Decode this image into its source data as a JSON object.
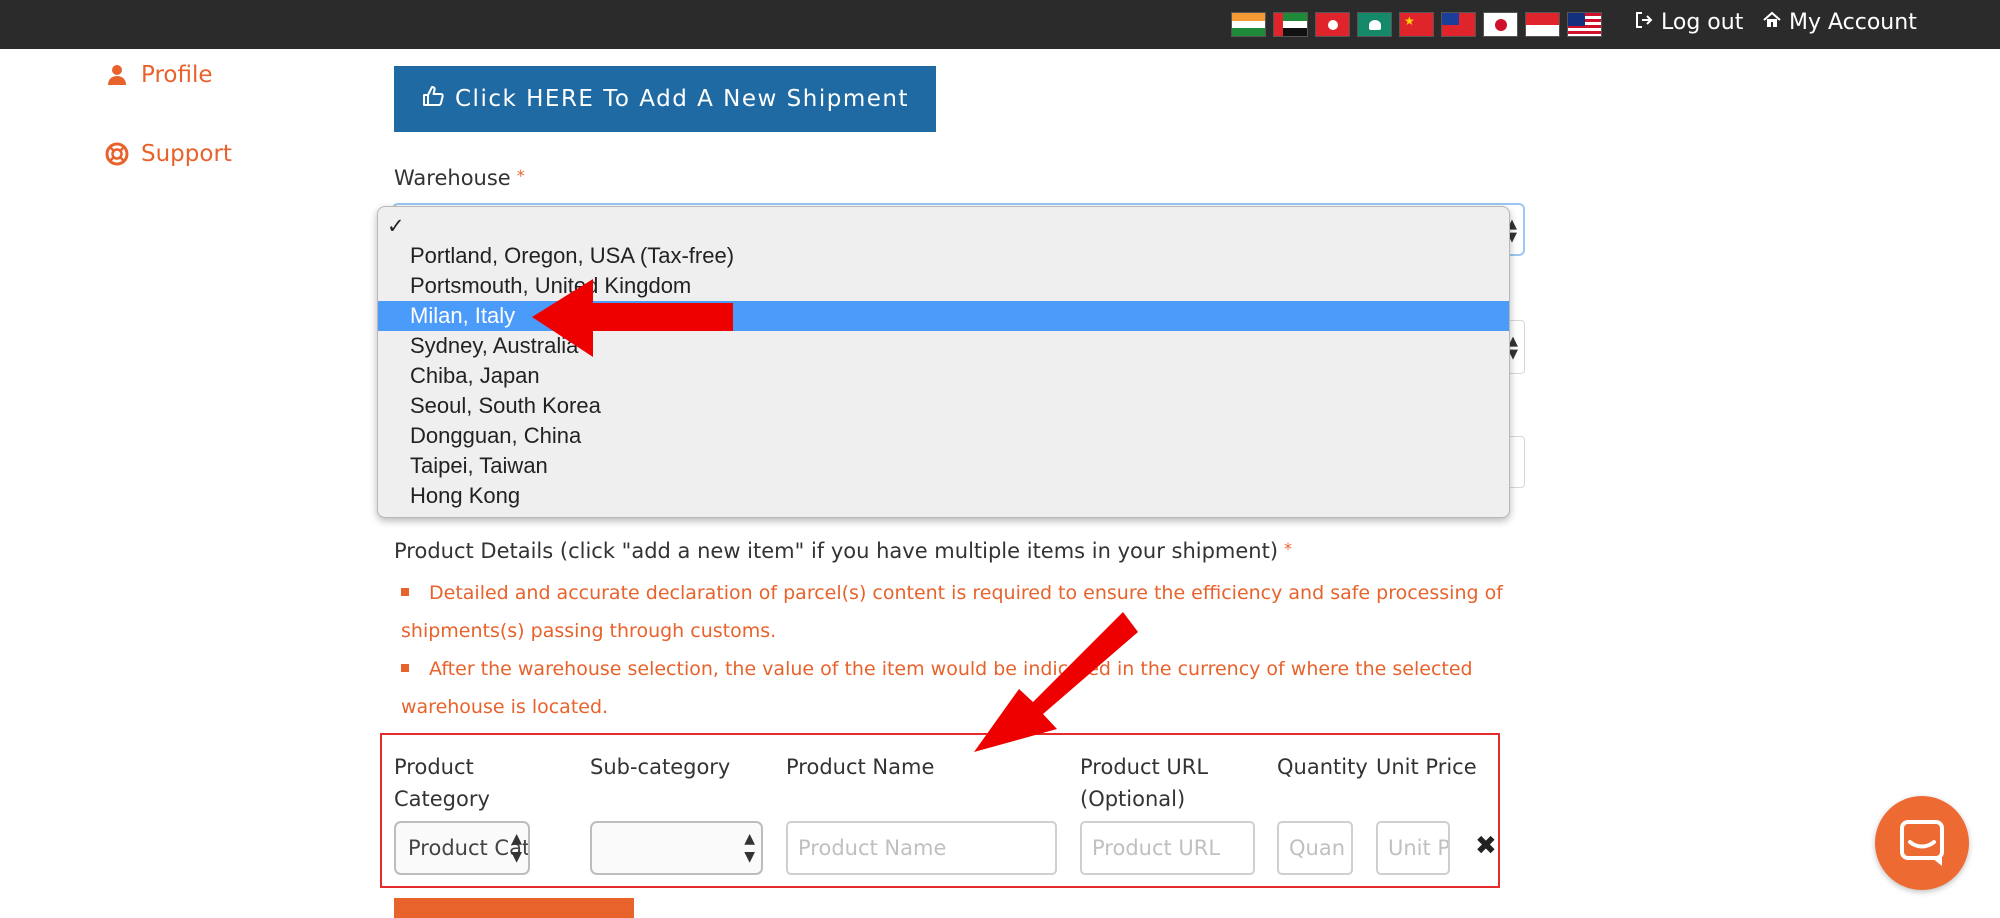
{
  "topbar": {
    "flags": [
      "flag-india-icon",
      "flag-uae-icon",
      "flag-hongkong-icon",
      "flag-macau-icon",
      "flag-china-icon",
      "flag-taiwan-icon",
      "flag-japan-icon",
      "flag-singapore-icon",
      "flag-malaysia-icon"
    ],
    "logout_label": "Log out",
    "account_label": "My Account"
  },
  "sidebar": {
    "items": [
      {
        "label": "Profile",
        "icon": "user-icon"
      },
      {
        "label": "Support",
        "icon": "lifebuoy-icon"
      }
    ]
  },
  "add_shipment_button": "Click HERE To Add A New Shipment",
  "warehouse": {
    "label": "Warehouse",
    "required_mark": "*",
    "check_mark": "✓",
    "selected_index": 2,
    "options": [
      "Portland, Oregon, USA (Tax-free)",
      "Portsmouth, United Kingdom",
      "Milan, Italy",
      "Sydney, Australia",
      "Chiba, Japan",
      "Seoul, South Korea",
      "Dongguan, China",
      "Taipei, Taiwan",
      "Hong Kong"
    ]
  },
  "product_details": {
    "heading": "Product Details (click \"add a new item\" if you have multiple items in your shipment)",
    "required_mark": "*",
    "notes": [
      "Detailed and accurate declaration of parcel(s) content is required to ensure the efficiency and safe processing of shipments(s) passing through customs.",
      "After the warehouse selection, the value of the item would be indicated in the currency of where the selected warehouse is located."
    ],
    "columns": {
      "category": "Product Category",
      "subcategory": "Sub-category",
      "name": "Product Name",
      "url": "Product URL (Optional)",
      "quantity": "Quantity",
      "unit_price": "Unit Price"
    },
    "row": {
      "category_value": "Product Cate",
      "subcategory_value": "",
      "name_placeholder": "Product Name",
      "url_placeholder": "Product URL",
      "quantity_placeholder": "Quan",
      "unit_price_placeholder": "Unit P",
      "remove_icon": "✖"
    }
  },
  "colors": {
    "accent_orange": "#e8622c",
    "button_blue": "#1f6aa3",
    "selected_option": "#4b9bfb",
    "annotation_red": "#e52b2b"
  }
}
